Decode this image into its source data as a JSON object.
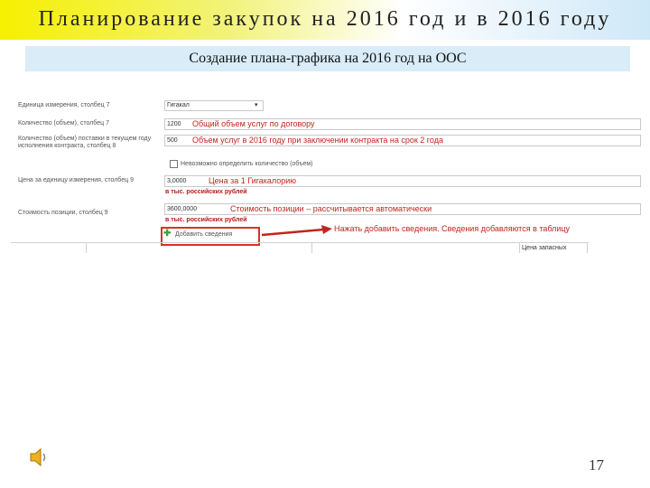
{
  "slide": {
    "title": "Планирование закупок на 2016 год и в 2016 году",
    "subtitle": "Создание плана-графика на 2016 год на ООС",
    "page_number": "17"
  },
  "form": {
    "unit_label": "Единица измерения, столбец 7",
    "unit_value": "Гигакал",
    "qty_label": "Количество (объем), столбец 7",
    "qty_value": "1200",
    "qty_note": "Общий объем услуг по договору",
    "qty_current_label": "Количество (объем) поставки в текущем году исполнения контракта, столбец 8",
    "qty_current_value": "500",
    "qty_current_note": "Объем услуг в 2016 году при заключении контракта на срок 2 года",
    "checkbox_label": "Невозможно определить количество (объем)",
    "price_label": "Цена за единицу измерения, столбец 9",
    "price_value": "3,0000",
    "price_note": "Цена за 1 Гигакалорию",
    "price_currency": "в тыс. российских рублей",
    "cost_label": "Стоимость позиции, столбец 9",
    "cost_value": "3600,0000",
    "cost_note": "Стоимость позиции – рассчитывается автоматически",
    "cost_currency": "в тыс. российских рублей",
    "add_button": "Добавить сведения",
    "add_hint": "Нажать добавить сведения. Сведения добавляются в таблицу",
    "table_col": "Цена запасных"
  },
  "colors": {
    "accent_red": "#c0261c",
    "subtitle_bg": "#d9ecf8",
    "title_yellow": "#f6f000"
  },
  "icons": [
    "speaker-icon",
    "plus-icon",
    "arrow-icon"
  ]
}
